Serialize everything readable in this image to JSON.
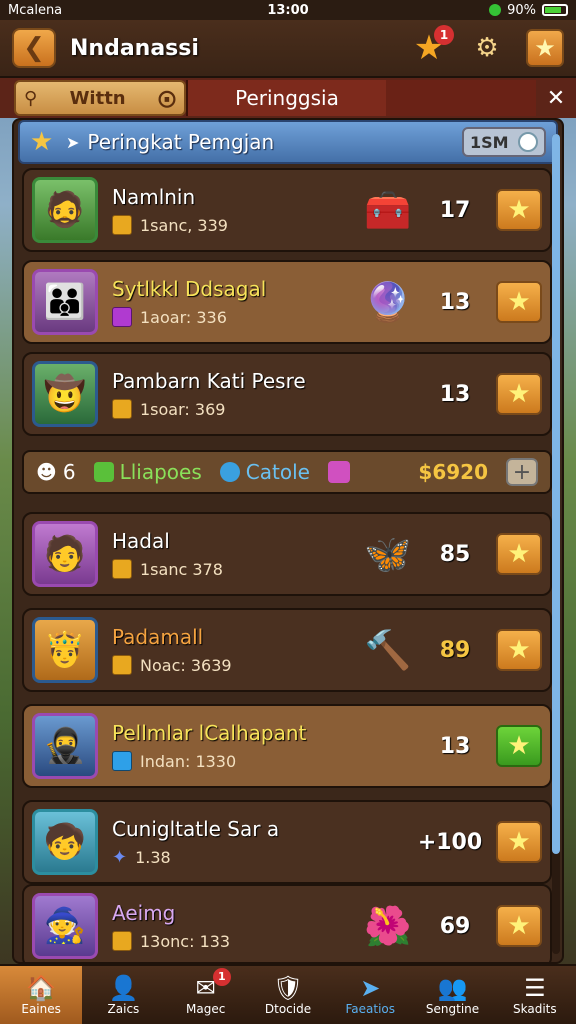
{
  "status": {
    "carrier": "Mcalena",
    "time": "13:00",
    "battery": "90%"
  },
  "header": {
    "title": "Nndanassi",
    "badge": "1",
    "back_icon": "back-arrow-icon",
    "star_icon": "star-icon",
    "gear_icon": "gear-icon"
  },
  "tabs": {
    "search_label": "Wittn",
    "active_label": "Peringgsia"
  },
  "section": {
    "title": "Peringkat Pemgjan",
    "pill": "1SM"
  },
  "players": [
    {
      "name": "Namlnin",
      "sub": "1sanc, 339",
      "score": "17",
      "avatar": "🧔",
      "item": "🧰",
      "light": false
    },
    {
      "name": "Sytlkkl Ddsagal",
      "sub": "1aoar: 336",
      "score": "13",
      "avatar": "👪",
      "item": "🔮",
      "light": true
    },
    {
      "name": "Pambarn Kati Pesre",
      "sub": "1soar: 369",
      "score": "13",
      "avatar": "🤠",
      "item": "",
      "light": false
    },
    {
      "name": "Hadal",
      "sub": "1sanc 378",
      "score": "85",
      "avatar": "🧑",
      "item": "🦋",
      "light": false
    },
    {
      "name": "Padamall",
      "sub": "Noac: 3639",
      "score": "89",
      "avatar": "🤴",
      "item": "🔨",
      "light": false
    },
    {
      "name": "Pellmlar lCalhapant",
      "sub": "Indan: 1330",
      "score": "13",
      "avatar": "🥷",
      "item": "",
      "light": true
    },
    {
      "name": "Cunigltatle Sar a",
      "sub": "1.38",
      "score": "+100",
      "avatar": "🧒",
      "item": "",
      "light": false
    },
    {
      "name": "Aeimg",
      "sub": "13onc: 133",
      "score": "69",
      "avatar": "🧙",
      "item": "🌺",
      "light": false
    }
  ],
  "resources": {
    "count": "6",
    "r1": "Lliapoes",
    "r2": "Catole",
    "gold": "$6920"
  },
  "nav": [
    {
      "label": "Eaines",
      "icon": "🏠",
      "badge": ""
    },
    {
      "label": "Zaics",
      "icon": "👤",
      "badge": ""
    },
    {
      "label": "Magec",
      "icon": "✉",
      "badge": "1"
    },
    {
      "label": "Dtocide",
      "icon": "🛡",
      "badge": ""
    },
    {
      "label": "Faeatios",
      "icon": "➤",
      "badge": ""
    },
    {
      "label": "Sengtine",
      "icon": "👥",
      "badge": ""
    },
    {
      "label": "Skadits",
      "icon": "☰",
      "badge": ""
    }
  ]
}
